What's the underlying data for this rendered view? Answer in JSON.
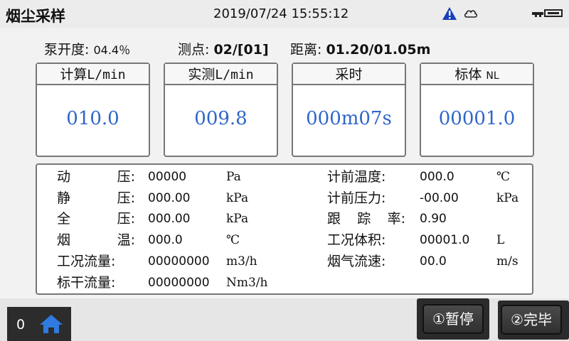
{
  "header": {
    "title": "烟尘采样",
    "datetime": "2019/07/24 15:55:12",
    "icons": [
      "warning-icon",
      "cloud-icon",
      "key-icon"
    ]
  },
  "params": {
    "pump_label": "泵开度:",
    "pump_value": "04.4％",
    "point_label": "测点:",
    "point_value": "02/[01]",
    "distance_label": "距离:",
    "distance_value": "01.20/01.05m"
  },
  "cards": [
    {
      "title": "计算",
      "unit": "L/min",
      "value": "010.0"
    },
    {
      "title": "实测",
      "unit": "L/min",
      "value": "009.8"
    },
    {
      "title": "采时",
      "unit": "",
      "value": "000m07s"
    },
    {
      "title": "标体",
      "unit": "NL",
      "value": "00001.0"
    }
  ],
  "left_rows": [
    {
      "label": [
        "动",
        "压:"
      ],
      "value": "00000",
      "unit": "Pa"
    },
    {
      "label": [
        "静",
        "压:"
      ],
      "value": "000.00",
      "unit": "kPa"
    },
    {
      "label": [
        "全",
        "压:"
      ],
      "value": "000.00",
      "unit": "kPa"
    },
    {
      "label": [
        "烟",
        "温:"
      ],
      "value": "000.0",
      "unit": "℃"
    },
    {
      "label": [
        "工况流量:"
      ],
      "value": "00000000",
      "unit": "m3/h"
    },
    {
      "label": [
        "标干流量:"
      ],
      "value": "00000000",
      "unit": "Nm3/h"
    }
  ],
  "right_rows": [
    {
      "label": [
        "计前温度:"
      ],
      "value": "000.0",
      "unit": "℃"
    },
    {
      "label": [
        "计前压力:"
      ],
      "value": "-00.00",
      "unit": "kPa"
    },
    {
      "label": [
        "跟",
        "踪",
        "率:"
      ],
      "value": "0.90",
      "unit": ""
    },
    {
      "label": [
        "工况体积:"
      ],
      "value": "00001.0",
      "unit": "L"
    },
    {
      "label": [
        "烟气流速:"
      ],
      "value": "00.0",
      "unit": "m/s"
    }
  ],
  "footer": {
    "page_number": "0",
    "pause_label": "①暂停",
    "done_label": "②完毕",
    "accent_color": "#2f66c8"
  }
}
